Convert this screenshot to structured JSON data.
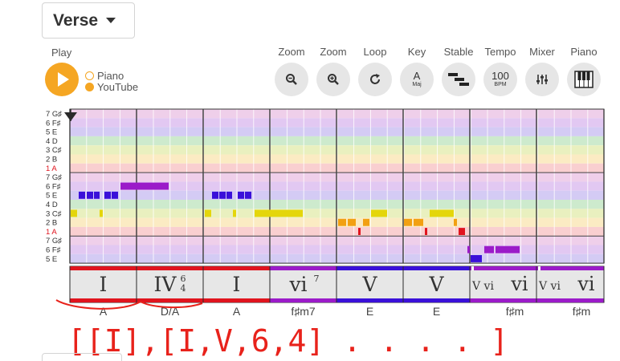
{
  "section": {
    "label": "Verse"
  },
  "playback": {
    "play_label": "Play",
    "sources": [
      {
        "label": "Piano",
        "selected": false
      },
      {
        "label": "YouTube",
        "selected": true
      }
    ]
  },
  "toolbar": {
    "zoom_out_label": "Zoom",
    "zoom_in_label": "Zoom",
    "loop_label": "Loop",
    "key_label": "Key",
    "key_value": "A",
    "key_mode": "Maj",
    "stable_label": "Stable",
    "tempo_label": "Tempo",
    "tempo_value": "100",
    "tempo_unit": "BPM",
    "mixer_label": "Mixer",
    "piano_label": "Piano"
  },
  "piano_roll": {
    "row_labels": [
      "7 G♯",
      "6 F♯",
      "5 E",
      "4 D",
      "3 C♯",
      "2 B",
      "1 A",
      "7 G♯",
      "6 F♯",
      "5 E",
      "4 D",
      "3 C♯",
      "2 B",
      "1 A",
      "7 G♯",
      "6 F♯",
      "5 E"
    ],
    "highlight_label": "1 A"
  },
  "chords": {
    "roman": [
      {
        "numeral": "I",
        "sup": "",
        "sub": ""
      },
      {
        "numeral": "IV",
        "sup": "6",
        "sub": "4"
      },
      {
        "numeral": "I",
        "sup": "",
        "sub": ""
      },
      {
        "numeral": "vi",
        "sup": "7",
        "sub": ""
      },
      {
        "numeral": "V",
        "sup": "",
        "sub": ""
      },
      {
        "numeral": "V",
        "sup": "",
        "sub": ""
      },
      {
        "numeral": "vi",
        "sup": "",
        "sub": "",
        "pre": "V vi"
      },
      {
        "numeral": "vi",
        "sup": "",
        "sub": "",
        "pre": "V vi"
      }
    ],
    "names": [
      "A",
      "D/A",
      "A",
      "f♯m7",
      "E",
      "E",
      "f♯m",
      "f♯m"
    ]
  },
  "annotation": {
    "text": "[[I],[I,V,6,4] . . . . ]",
    "color": "#e8221b"
  },
  "colors": {
    "accent": "#f5a623",
    "tonic": "#e0141e",
    "subdominant": "#9b1bc9",
    "dominant": "#3a10d9",
    "melody_mid": "#e4d60b",
    "melody_low": "#f2a012"
  }
}
